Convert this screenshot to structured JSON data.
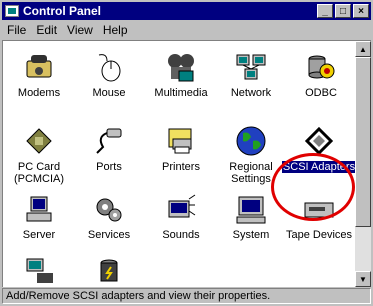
{
  "window": {
    "title": "Control Panel"
  },
  "title_buttons": {
    "minimize": "_",
    "maximize": "□",
    "close": "×"
  },
  "menu": [
    {
      "label": "File"
    },
    {
      "label": "Edit"
    },
    {
      "label": "View"
    },
    {
      "label": "Help"
    }
  ],
  "icons": [
    {
      "label": "Modems",
      "icon": "modem-icon"
    },
    {
      "label": "Mouse",
      "icon": "mouse-icon"
    },
    {
      "label": "Multimedia",
      "icon": "multimedia-icon"
    },
    {
      "label": "Network",
      "icon": "network-icon"
    },
    {
      "label": "ODBC",
      "icon": "odbc-icon"
    },
    {
      "label": "PC Card (PCMCIA)",
      "icon": "pc-card-icon"
    },
    {
      "label": "Ports",
      "icon": "ports-icon"
    },
    {
      "label": "Printers",
      "icon": "printers-icon"
    },
    {
      "label": "Regional Settings",
      "icon": "globe-icon"
    },
    {
      "label": "SCSI Adapters",
      "icon": "scsi-icon",
      "selected": true
    },
    {
      "label": "Server",
      "icon": "server-icon"
    },
    {
      "label": "Services",
      "icon": "services-icon"
    },
    {
      "label": "Sounds",
      "icon": "sounds-icon"
    },
    {
      "label": "System",
      "icon": "system-icon"
    },
    {
      "label": "Tape Devices",
      "icon": "tape-icon"
    },
    {
      "label": "",
      "icon": "telephony-icon"
    },
    {
      "label": "",
      "icon": "ups-icon"
    }
  ],
  "status": {
    "text": "Add/Remove SCSI adapters and view their properties."
  },
  "colors": {
    "titlebar": "#000080",
    "selection": "#000080",
    "highlight_circle": "#e00000"
  }
}
